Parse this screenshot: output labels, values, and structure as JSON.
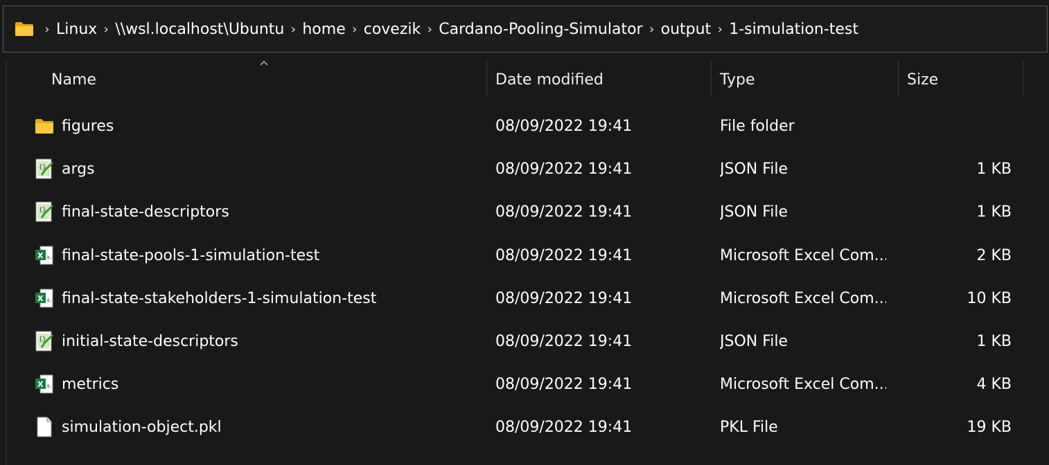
{
  "breadcrumb": {
    "items": [
      "Linux",
      "\\\\wsl.localhost\\Ubuntu",
      "home",
      "covezik",
      "Cardano-Pooling-Simulator",
      "output",
      "1-simulation-test"
    ],
    "separator": ">"
  },
  "columns": {
    "name": "Name",
    "date": "Date modified",
    "type": "Type",
    "size": "Size"
  },
  "files": [
    {
      "name": "figures",
      "date": "08/09/2022 19:41",
      "type": "File folder",
      "size": "",
      "icon": "folder-icon"
    },
    {
      "name": "args",
      "date": "08/09/2022 19:41",
      "type": "JSON File",
      "size": "1 KB",
      "icon": "json-file-icon"
    },
    {
      "name": "final-state-descriptors",
      "date": "08/09/2022 19:41",
      "type": "JSON File",
      "size": "1 KB",
      "icon": "json-file-icon"
    },
    {
      "name": "final-state-pools-1-simulation-test",
      "date": "08/09/2022 19:41",
      "type": "Microsoft Excel Com...",
      "size": "2 KB",
      "icon": "excel-file-icon"
    },
    {
      "name": "final-state-stakeholders-1-simulation-test",
      "date": "08/09/2022 19:41",
      "type": "Microsoft Excel Com...",
      "size": "10 KB",
      "icon": "excel-file-icon"
    },
    {
      "name": "initial-state-descriptors",
      "date": "08/09/2022 19:41",
      "type": "JSON File",
      "size": "1 KB",
      "icon": "json-file-icon"
    },
    {
      "name": "metrics",
      "date": "08/09/2022 19:41",
      "type": "Microsoft Excel Com...",
      "size": "4 KB",
      "icon": "excel-file-icon"
    },
    {
      "name": "simulation-object.pkl",
      "date": "08/09/2022 19:41",
      "type": "PKL File",
      "size": "19 KB",
      "icon": "generic-file-icon"
    }
  ],
  "colors": {
    "background": "#191919",
    "text": "#ffffff",
    "folder": "#f8c842",
    "excel": "#1d7a45"
  }
}
